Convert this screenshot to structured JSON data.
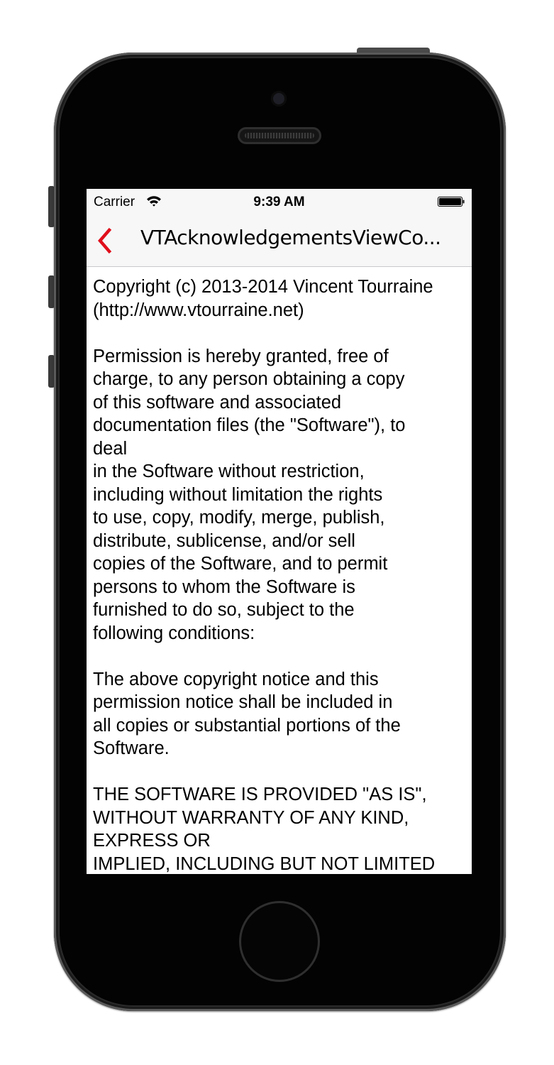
{
  "status_bar": {
    "carrier": "Carrier",
    "time": "9:39 AM",
    "wifi_icon": "wifi-icon",
    "battery_icon": "battery-icon"
  },
  "nav_bar": {
    "back_icon": "chevron-left-icon",
    "title": "VTAcknowledgementsViewCo...",
    "accent_color": "#e00f1b"
  },
  "license": {
    "lines": [
      "Copyright (c) 2013-2014 Vincent Tourraine",
      "(http://www.vtourraine.net)",
      "",
      "Permission is hereby granted, free of",
      "charge, to any person obtaining a copy",
      "of this software and associated",
      "documentation files (the \"Software\"), to",
      "deal",
      "in the Software without restriction,",
      "including without limitation the rights",
      "to use, copy, modify, merge, publish,",
      "distribute, sublicense, and/or sell",
      "copies of the Software, and to permit",
      "persons to whom the Software is",
      "furnished to do so, subject to the",
      "following conditions:",
      "",
      "The above copyright notice and this",
      "permission notice shall be included in",
      "all copies or substantial portions of the",
      "Software.",
      "",
      "THE SOFTWARE IS PROVIDED \"AS IS\",",
      "WITHOUT WARRANTY OF ANY KIND,",
      "EXPRESS OR",
      "IMPLIED, INCLUDING BUT NOT LIMITED"
    ]
  }
}
